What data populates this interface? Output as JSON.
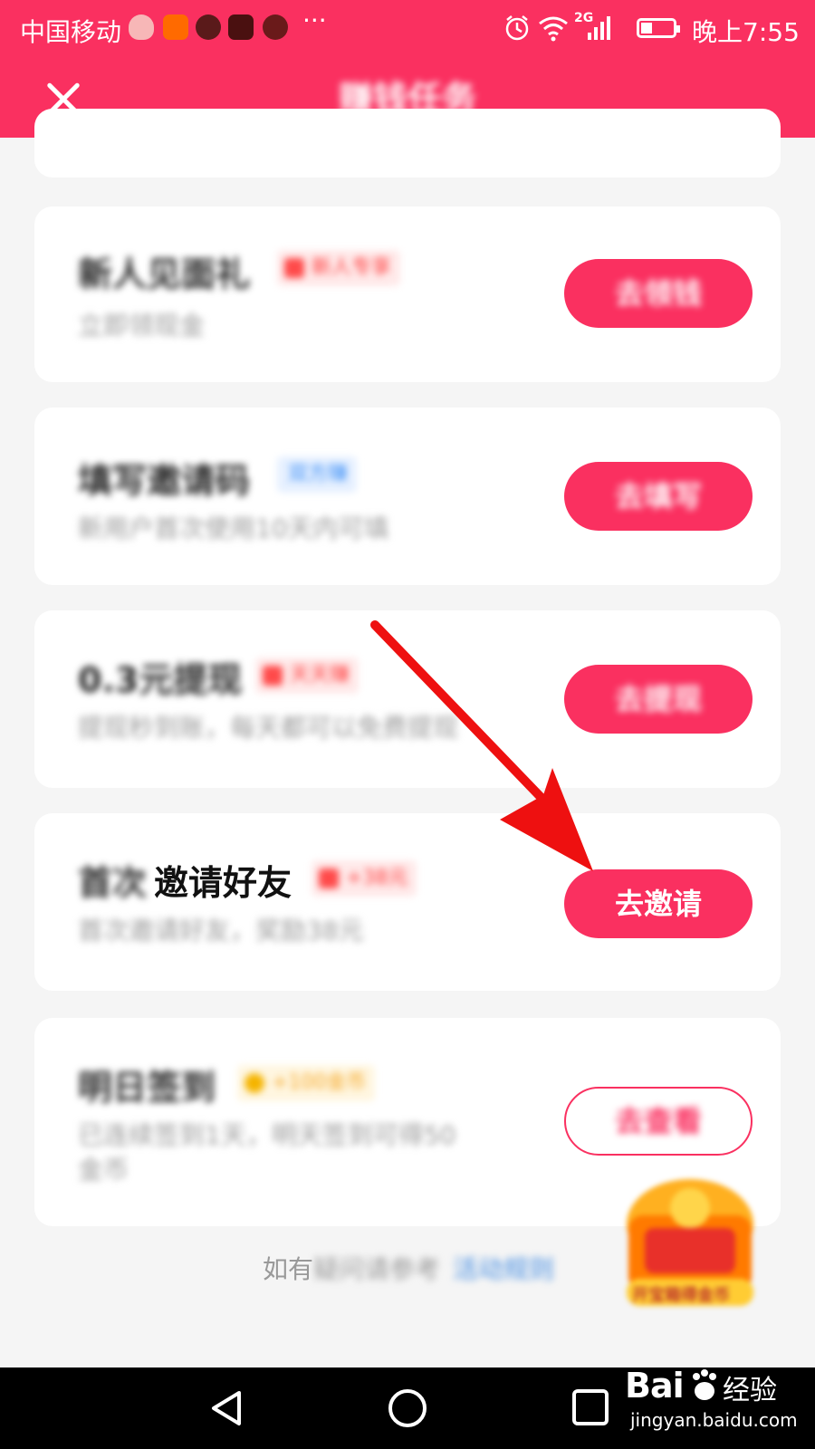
{
  "status_bar": {
    "carrier": "中国移动",
    "more": "···",
    "signal_label": "2G",
    "time": "晚上7:55"
  },
  "header": {
    "title": "赚钱任务"
  },
  "tasks": [
    {
      "title": "新人见面礼",
      "tag": "新人专享",
      "tag_color": "#ff3b3b",
      "subtitle": "立即领现金",
      "button": "去领钱"
    },
    {
      "title": "填写邀请码",
      "tag": "双方赚",
      "tag_color": "#3a8ef6",
      "subtitle": "新用户首次使用10天内可填",
      "button": "去填写"
    },
    {
      "title": "0.3元提现",
      "tag": "天天赚",
      "tag_color": "#ff3b3b",
      "subtitle": "提现秒到账，每天都可以免费提现",
      "button": "去提现"
    },
    {
      "title_prefix": "首次",
      "title": "邀请好友",
      "tag": "+38元",
      "tag_color": "#ff3b3b",
      "subtitle": "首次邀请好友，奖励38元",
      "button": "去邀请"
    },
    {
      "title": "明日签到",
      "tag": "+100金币",
      "tag_color": "#f5a623",
      "subtitle_line1": "已连续签到1天，明天签到可得50",
      "subtitle_line2": "金币",
      "button": "去查看"
    }
  ],
  "footer": {
    "prefix": "如有",
    "rest": "疑问请参考",
    "link": "活动规则"
  },
  "float_badge": {
    "label": "开宝箱得金币"
  },
  "watermark": {
    "brand": "Bai",
    "cn": "经验",
    "url": "jingyan.baidu.com"
  },
  "colors": {
    "accent": "#fa3060",
    "annotation_arrow": "#ee1010"
  }
}
